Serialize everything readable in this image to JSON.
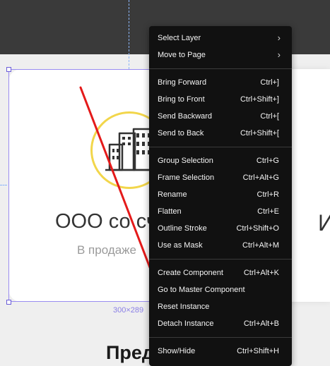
{
  "canvas": {
    "frame_size_label": "300×289",
    "company_title": "ООО со сч",
    "company_subtitle": "В продаже",
    "right_fragment": "И",
    "bottom_heading": "Предл          гист",
    "colors": {
      "accent_ring": "#f2d64b",
      "selection": "#9a8cf0",
      "annotation_line": "#e41a1a"
    },
    "logo_icon": "building-icon"
  },
  "context_menu": {
    "sections": [
      {
        "items": [
          {
            "label": "Select Layer",
            "shortcut": "",
            "submenu": true
          },
          {
            "label": "Move to Page",
            "shortcut": "",
            "submenu": true
          }
        ]
      },
      {
        "items": [
          {
            "label": "Bring Forward",
            "shortcut": "Ctrl+]"
          },
          {
            "label": "Bring to Front",
            "shortcut": "Ctrl+Shift+]"
          },
          {
            "label": "Send Backward",
            "shortcut": "Ctrl+["
          },
          {
            "label": "Send to Back",
            "shortcut": "Ctrl+Shift+["
          }
        ]
      },
      {
        "items": [
          {
            "label": "Group Selection",
            "shortcut": "Ctrl+G"
          },
          {
            "label": "Frame Selection",
            "shortcut": "Ctrl+Alt+G"
          },
          {
            "label": "Rename",
            "shortcut": "Ctrl+R"
          },
          {
            "label": "Flatten",
            "shortcut": "Ctrl+E"
          },
          {
            "label": "Outline Stroke",
            "shortcut": "Ctrl+Shift+O"
          },
          {
            "label": "Use as Mask",
            "shortcut": "Ctrl+Alt+M"
          }
        ]
      },
      {
        "items": [
          {
            "label": "Create Component",
            "shortcut": "Ctrl+Alt+K"
          },
          {
            "label": "Go to Master Component",
            "shortcut": ""
          },
          {
            "label": "Reset Instance",
            "shortcut": ""
          },
          {
            "label": "Detach Instance",
            "shortcut": "Ctrl+Alt+B"
          }
        ]
      },
      {
        "items": [
          {
            "label": "Show/Hide",
            "shortcut": "Ctrl+Shift+H"
          }
        ]
      }
    ]
  }
}
